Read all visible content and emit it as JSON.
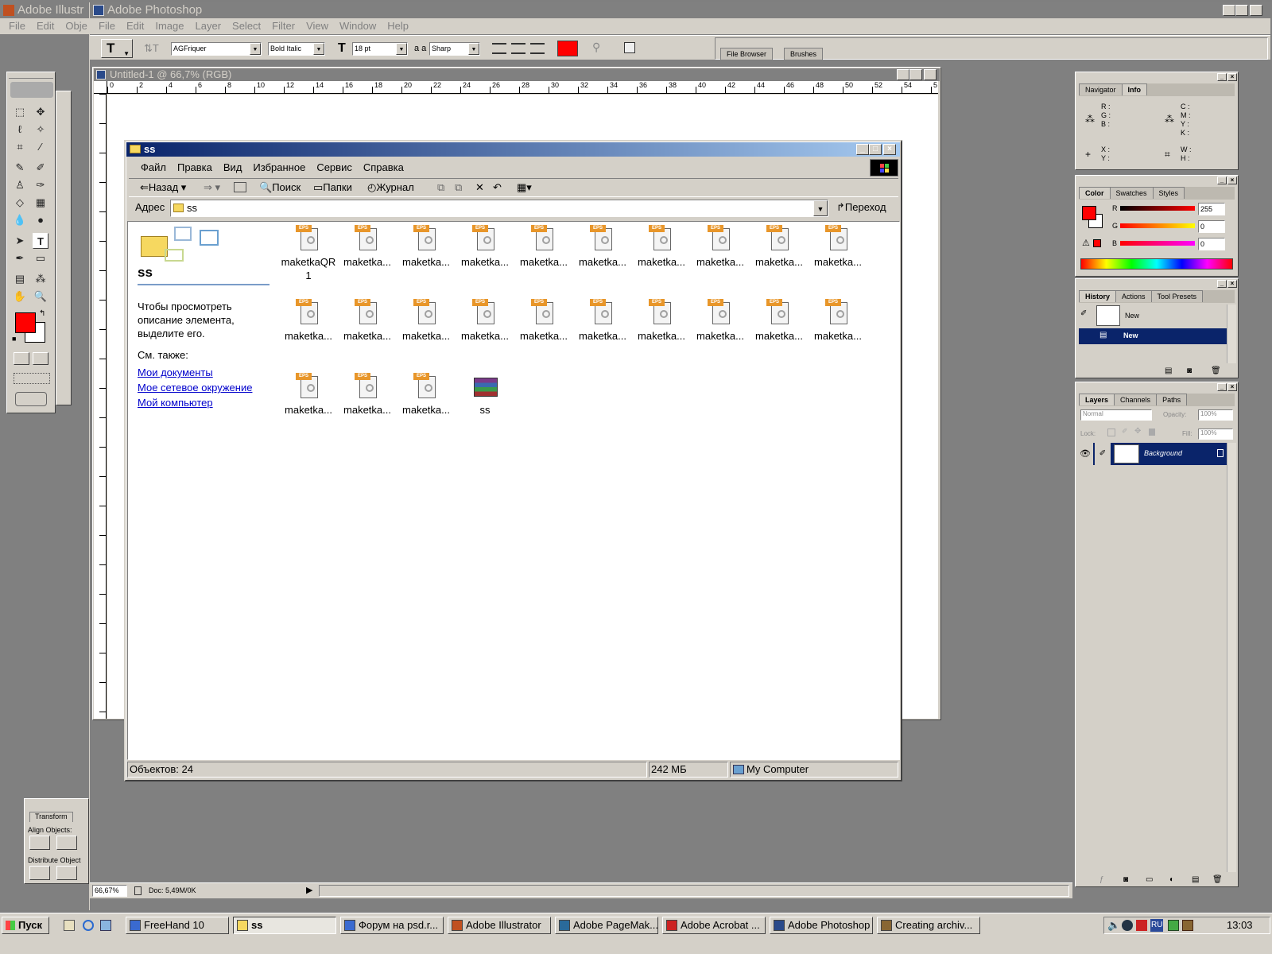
{
  "illustrator": {
    "title": "Adobe Illustr",
    "menu": [
      "File",
      "Edit",
      "Obje"
    ]
  },
  "photoshop": {
    "title": "Adobe Photoshop",
    "menu": [
      "File",
      "Edit",
      "Image",
      "Layer",
      "Select",
      "Filter",
      "View",
      "Window",
      "Help"
    ],
    "options": {
      "font_family": "AGFriquer",
      "font_style": "Bold Italic",
      "font_size": "18 pt",
      "aa_label": "a a",
      "aa": "Sharp",
      "text_color": "#ff0000"
    },
    "well_tabs": [
      "File Browser",
      "Brushes"
    ],
    "doc": {
      "title": "Untitled-1 @ 66,7% (RGB)",
      "ruler_labels": [
        "0",
        "2",
        "4",
        "6",
        "8",
        "10",
        "12",
        "14",
        "16",
        "18",
        "20",
        "22",
        "24",
        "26",
        "28",
        "30",
        "32",
        "34",
        "36",
        "38",
        "40",
        "42",
        "44",
        "46",
        "48",
        "50",
        "52",
        "54",
        "5"
      ]
    },
    "status": {
      "zoom": "66,67%",
      "doc": "Doc: 5,49M/0K"
    },
    "foreground": "#ff0000",
    "background": "#ffffff"
  },
  "explorer": {
    "title": "ss",
    "menu": [
      "Файл",
      "Правка",
      "Вид",
      "Избранное",
      "Сервис",
      "Справка"
    ],
    "toolbar": {
      "back": "Назад",
      "search": "Поиск",
      "folders": "Папки",
      "history": "Журнал"
    },
    "address": {
      "label": "Адрес",
      "value": "ss",
      "go": "Переход"
    },
    "left": {
      "folder_name": "ss",
      "hint": "Чтобы просмотреть описание элемента, выделите его.",
      "see_also": "См. также:",
      "links": [
        "Мои документы",
        "Мое сетевое окружение",
        "Мой компьютер"
      ]
    },
    "items": [
      {
        "name": "maketkaQR 1",
        "type": "eps"
      },
      {
        "name": "maketka...",
        "type": "eps"
      },
      {
        "name": "maketka...",
        "type": "eps"
      },
      {
        "name": "maketka...",
        "type": "eps"
      },
      {
        "name": "maketka...",
        "type": "eps"
      },
      {
        "name": "maketka...",
        "type": "eps"
      },
      {
        "name": "maketka...",
        "type": "eps"
      },
      {
        "name": "maketka...",
        "type": "eps"
      },
      {
        "name": "maketka...",
        "type": "eps"
      },
      {
        "name": "maketka...",
        "type": "eps"
      },
      {
        "name": "maketka...",
        "type": "eps"
      },
      {
        "name": "maketka...",
        "type": "eps"
      },
      {
        "name": "maketka...",
        "type": "eps"
      },
      {
        "name": "maketka...",
        "type": "eps"
      },
      {
        "name": "maketka...",
        "type": "eps"
      },
      {
        "name": "maketka...",
        "type": "eps"
      },
      {
        "name": "maketka...",
        "type": "eps"
      },
      {
        "name": "maketka...",
        "type": "eps"
      },
      {
        "name": "maketka...",
        "type": "eps"
      },
      {
        "name": "maketka...",
        "type": "eps"
      },
      {
        "name": "maketka...",
        "type": "eps"
      },
      {
        "name": "maketka...",
        "type": "eps"
      },
      {
        "name": "maketka...",
        "type": "eps"
      },
      {
        "name": "ss",
        "type": "rar"
      }
    ],
    "status": {
      "objects": "Объектов: 24",
      "size": "242 МБ",
      "zone": "My Computer"
    }
  },
  "palettes": {
    "nav": {
      "tabs": [
        "Navigator",
        "Info"
      ],
      "rgb": "R :\nG :\nB :",
      "cmyk": "C :\nM :\nY :\nK :",
      "xy": "X :\nY :",
      "wh": "W :\nH :"
    },
    "color": {
      "tabs": [
        "Color",
        "Swatches",
        "Styles"
      ],
      "r": "255",
      "g": "0",
      "b": "0",
      "r_label": "R",
      "g_label": "G",
      "b_label": "B"
    },
    "history": {
      "tabs": [
        "History",
        "Actions",
        "Tool Presets"
      ],
      "snapshot": "New",
      "step": "New"
    },
    "layers": {
      "tabs": [
        "Layers",
        "Channels",
        "Paths"
      ],
      "mode": "Normal",
      "opacity_label": "Opacity:",
      "opacity": "100%",
      "lock_label": "Lock:",
      "fill_label": "Fill:",
      "fill": "100%",
      "layer": "Background"
    },
    "transform": {
      "tab": "Transform",
      "align": "Align Objects:",
      "distribute": "Distribute Object"
    }
  },
  "taskbar": {
    "start": "Пуск",
    "items": [
      "FreeHand 10",
      "ss",
      "Форум на psd.r...",
      "Adobe Illustrator",
      "Adobe PageMak...",
      "Adobe Acrobat ...",
      "Adobe Photoshop",
      "Creating archiv..."
    ],
    "active": 1,
    "lang": "RU",
    "clock": "13:03"
  }
}
